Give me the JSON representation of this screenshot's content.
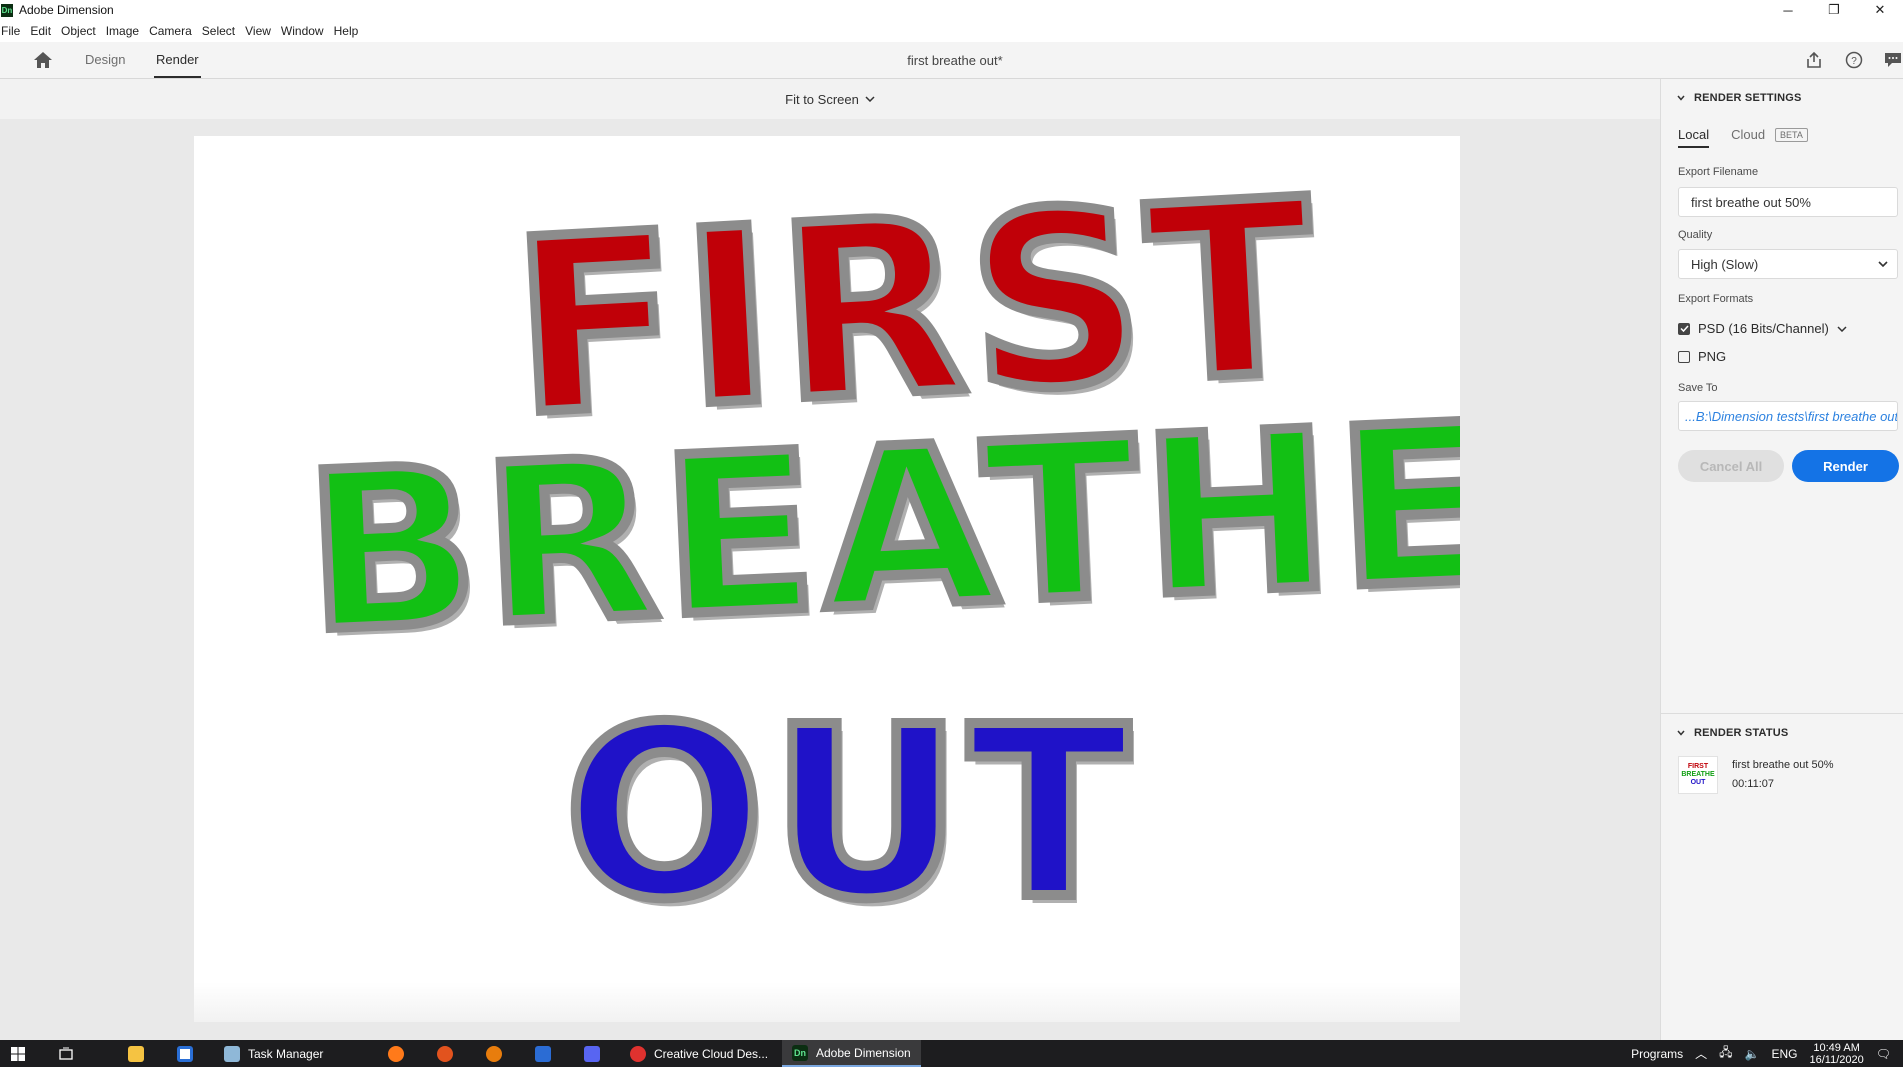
{
  "window": {
    "app_title": "Adobe Dimension",
    "badge": "Dn",
    "controls": [
      "─",
      "❐",
      "✕"
    ]
  },
  "menu": [
    "File",
    "Edit",
    "Object",
    "Image",
    "Camera",
    "Select",
    "View",
    "Window",
    "Help"
  ],
  "toolbar": {
    "tabs": [
      "Design",
      "Render"
    ],
    "active_tab": "Render",
    "doc_title": "first breathe out*"
  },
  "canvas": {
    "zoom_label": "Fit to Screen",
    "scene_words": [
      "FIRST",
      "BREATHE",
      "OUT"
    ],
    "colors": {
      "first": "#c00008",
      "breathe": "#12c014",
      "out": "#1f12c8",
      "outline": "#8c8c8c"
    }
  },
  "render_settings": {
    "heading": "RENDER SETTINGS",
    "tabs": [
      "Local",
      "Cloud"
    ],
    "beta_badge": "BETA",
    "export_filename_label": "Export Filename",
    "export_filename": "first breathe out 50%",
    "quality_label": "Quality",
    "quality_value": "High (Slow)",
    "formats_label": "Export Formats",
    "formats": [
      {
        "label": "PSD (16 Bits/Channel)",
        "checked": true
      },
      {
        "label": "PNG",
        "checked": false
      }
    ],
    "save_to_label": "Save To",
    "save_to_value": "...B:\\Dimension tests\\first breathe out",
    "cancel_all": "Cancel All",
    "render": "Render",
    "accent": "#1473e6"
  },
  "render_status": {
    "heading": "RENDER STATUS",
    "thumb_lines": [
      "FIRST",
      "BREATHE",
      "OUT"
    ],
    "item_name": "first breathe out 50%",
    "item_time": "00:11:07"
  },
  "taskbar": {
    "task_manager": "Task Manager",
    "creative_cloud": "Creative Cloud Des...",
    "adobe_dimension": "Adobe Dimension",
    "programs": "Programs",
    "lang": "ENG",
    "time": "10:49 AM",
    "date": "16/11/2020"
  }
}
